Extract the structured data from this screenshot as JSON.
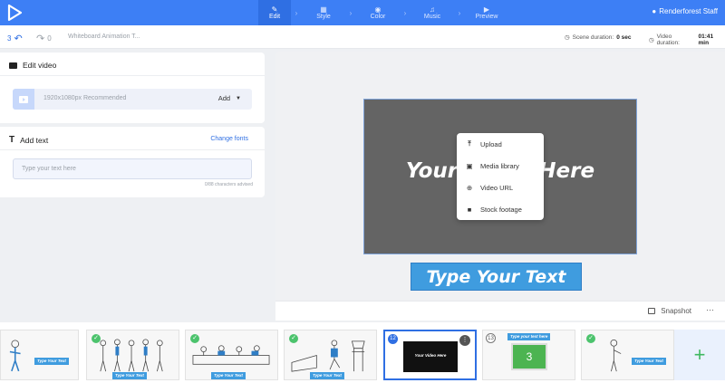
{
  "topbar": {
    "steps": [
      {
        "label": "Edit",
        "icon": "pencil-icon",
        "active": true
      },
      {
        "label": "Style",
        "icon": "style-icon",
        "active": false
      },
      {
        "label": "Color",
        "icon": "palette-icon",
        "active": false
      },
      {
        "label": "Music",
        "icon": "music-icon",
        "active": false
      },
      {
        "label": "Preview",
        "icon": "play-icon",
        "active": false
      }
    ],
    "user_name": "Renderforest Staff"
  },
  "subbar": {
    "undo_count": "3",
    "redo_count": "0",
    "project_title": "Whiteboard Animation T...",
    "scene_duration_label": "Scene duration:",
    "scene_duration_value": "0 sec",
    "video_duration_label": "Video duration:",
    "video_duration_value": "01:41 min"
  },
  "edit_video": {
    "title": "Edit video",
    "upload_hint": "1920x1080px Recommended",
    "add_label": "Add"
  },
  "add_text": {
    "title": "Add text",
    "change_fonts": "Change fonts",
    "placeholder": "Type your text here",
    "char_count": "0/88 characters advised"
  },
  "preview": {
    "video_text": "Your Video Here",
    "banner_text": "Type Your Text",
    "snapshot_label": "Snapshot",
    "more": "···"
  },
  "menu": {
    "items": [
      {
        "label": "Upload",
        "icon": "upload-icon"
      },
      {
        "label": "Media library",
        "icon": "media-library-icon"
      },
      {
        "label": "Video URL",
        "icon": "globe-icon"
      },
      {
        "label": "Stock footage",
        "icon": "camera-icon"
      }
    ]
  },
  "timeline": {
    "scenes": [
      {
        "tag": "Type Your Text",
        "checked": false
      },
      {
        "tag": "Type Your Text",
        "checked": true
      },
      {
        "tag": "Type Your Text",
        "checked": true
      },
      {
        "tag": "Type Your Text",
        "checked": true
      },
      {
        "number": "12",
        "tag": "Your Video Here",
        "selected": true
      },
      {
        "number": "13",
        "tag": "Type your text here",
        "center_number": "3"
      },
      {
        "tag": "Type Your Text",
        "checked": true
      }
    ],
    "add_symbol": "+"
  },
  "colors": {
    "brand": "#3d7ff5",
    "accent": "#3f9cdf",
    "check": "#4cc36d"
  }
}
